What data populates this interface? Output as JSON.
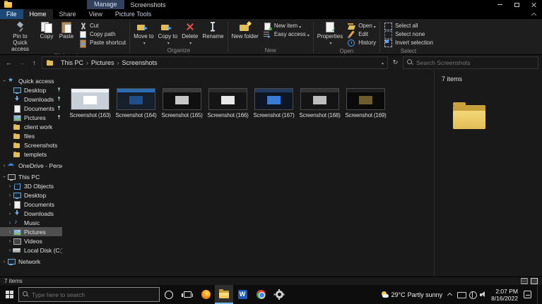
{
  "titlebar": {
    "contextual_tab": "Manage",
    "title": "Screenshots"
  },
  "tabs": {
    "file_label": "File",
    "items": [
      {
        "label": "Home",
        "selected": true
      },
      {
        "label": "Share"
      },
      {
        "label": "View"
      }
    ],
    "contextual_label": "Picture Tools"
  },
  "ribbon": {
    "groups": [
      {
        "label": "Clipboard",
        "big": [
          {
            "label": "Pin to Quick access",
            "icon": "pin-icon"
          },
          {
            "label": "Copy",
            "icon": "copy-icon"
          },
          {
            "label": "Paste",
            "icon": "paste-icon"
          }
        ],
        "small": [
          {
            "label": "Cut",
            "icon": "cut-icon"
          },
          {
            "label": "Copy path",
            "icon": "copy-path-icon"
          },
          {
            "label": "Paste shortcut",
            "icon": "paste-shortcut-icon"
          }
        ]
      },
      {
        "label": "Organize",
        "big": [
          {
            "label": "Move to",
            "icon": "move-to-icon",
            "dd": true
          },
          {
            "label": "Copy to",
            "icon": "copy-to-icon",
            "dd": true
          },
          {
            "label": "Delete",
            "icon": "delete-icon",
            "dd": true
          },
          {
            "label": "Rename",
            "icon": "rename-icon"
          }
        ]
      },
      {
        "label": "New",
        "big": [
          {
            "label": "New folder",
            "icon": "new-folder-icon"
          }
        ],
        "small": [
          {
            "label": "New item",
            "icon": "new-item-icon",
            "dd": true
          },
          {
            "label": "Easy access",
            "icon": "easy-access-icon",
            "dd": true
          }
        ]
      },
      {
        "label": "Open",
        "big": [
          {
            "label": "Properties",
            "icon": "properties-icon",
            "dd": true
          }
        ],
        "small": [
          {
            "label": "Open",
            "icon": "open-icon",
            "dd": true
          },
          {
            "label": "Edit",
            "icon": "edit-icon"
          },
          {
            "label": "History",
            "icon": "history-icon"
          }
        ]
      },
      {
        "label": "Select",
        "small": [
          {
            "label": "Select all",
            "icon": "select-all-icon"
          },
          {
            "label": "Select none",
            "icon": "select-none-icon"
          },
          {
            "label": "Invert selection",
            "icon": "invert-selection-icon"
          }
        ]
      }
    ]
  },
  "addressbar": {
    "breadcrumb": [
      "This PC",
      "Pictures",
      "Screenshots"
    ],
    "search_placeholder": "Search Screenshots"
  },
  "sidebar": {
    "sections": [
      {
        "label": "Quick access",
        "icon": "quick-access-icon",
        "expanded": true,
        "items": [
          {
            "label": "Desktop",
            "icon": "desktop-icon",
            "pinned": true
          },
          {
            "label": "Downloads",
            "icon": "downloads-icon",
            "pinned": true
          },
          {
            "label": "Documents",
            "icon": "documents-icon",
            "pinned": true
          },
          {
            "label": "Pictures",
            "icon": "pictures-icon",
            "pinned": true
          },
          {
            "label": "client work",
            "icon": "folder-icon"
          },
          {
            "label": "files",
            "icon": "folder-icon"
          },
          {
            "label": "Screenshots",
            "icon": "folder-icon"
          },
          {
            "label": "templets",
            "icon": "folder-icon"
          }
        ]
      },
      {
        "label": "OneDrive - Personal",
        "icon": "onedrive-icon",
        "expanded": false,
        "items": []
      },
      {
        "label": "This PC",
        "icon": "this-pc-icon",
        "expanded": true,
        "items": [
          {
            "label": "3D Objects",
            "icon": "3d-objects-icon",
            "expandable": true
          },
          {
            "label": "Desktop",
            "icon": "desktop-icon",
            "expandable": true
          },
          {
            "label": "Documents",
            "icon": "documents-icon",
            "expandable": true
          },
          {
            "label": "Downloads",
            "icon": "downloads-icon",
            "expandable": true
          },
          {
            "label": "Music",
            "icon": "music-icon",
            "expandable": true
          },
          {
            "label": "Pictures",
            "icon": "pictures-icon",
            "expandable": true,
            "selected": true
          },
          {
            "label": "Videos",
            "icon": "videos-icon",
            "expandable": true
          },
          {
            "label": "Local Disk (C:)",
            "icon": "disk-icon",
            "expandable": true
          }
        ]
      },
      {
        "label": "Network",
        "icon": "network-icon",
        "expanded": false,
        "items": []
      }
    ]
  },
  "files": {
    "items": [
      {
        "label": "Screenshot (163)",
        "thumb": {
          "bg": "#c7d0d8",
          "bar": "#eef2f5",
          "block": "#ffffff"
        }
      },
      {
        "label": "Screenshot (164)",
        "thumb": {
          "bg": "#16202c",
          "bar": "#2a6db5",
          "block": "#1e4f8a"
        }
      },
      {
        "label": "Screenshot (165)",
        "thumb": {
          "bg": "#101010",
          "bar": "#3a3a3a",
          "block": "#c8c8c8"
        }
      },
      {
        "label": "Screenshot (166)",
        "thumb": {
          "bg": "#151515",
          "bar": "#2a2a2a",
          "block": "#e8e8e8"
        }
      },
      {
        "label": "Screenshot (167)",
        "thumb": {
          "bg": "#0e1624",
          "bar": "#223a5e",
          "block": "#3a7bd5"
        }
      },
      {
        "label": "Screenshot (168)",
        "thumb": {
          "bg": "#141414",
          "bar": "#333333",
          "block": "#bdbdbd"
        }
      },
      {
        "label": "Screenshot (169)",
        "thumb": {
          "bg": "#0a0a0a",
          "bar": "#1f1f1f",
          "block": "#6b5d2e"
        }
      }
    ]
  },
  "preview": {
    "header": "7 items"
  },
  "statusbar": {
    "items_text": "7 items"
  },
  "taskbar": {
    "search_placeholder": "Type here to search",
    "apps": [
      {
        "name": "cortana"
      },
      {
        "name": "task-view"
      },
      {
        "name": "firefox"
      },
      {
        "name": "file-explorer",
        "active": true
      },
      {
        "name": "word"
      },
      {
        "name": "chrome"
      },
      {
        "name": "settings"
      }
    ],
    "weather": {
      "temp": "29°C",
      "condition": "Partly sunny"
    },
    "clock": {
      "time": "2:07 PM",
      "date": "8/16/2022"
    }
  },
  "colors": {
    "accent": "#76b9ed",
    "folder": "#e2bd56",
    "ribbon_bg": "#1e1e1e",
    "window_bg": "#191919",
    "taskbar_bg": "#0d0d0d"
  }
}
